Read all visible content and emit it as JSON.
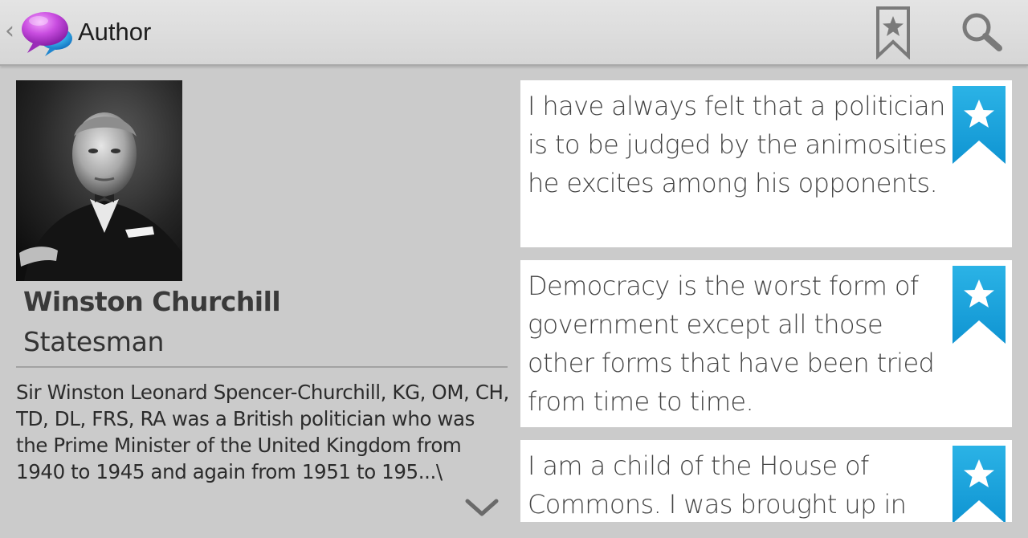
{
  "actionbar": {
    "title": "Author",
    "up_icon": "chevron-left-icon",
    "app_icon": "speech-bubbles-icon",
    "actions": [
      {
        "name": "bookmark-star-icon"
      },
      {
        "name": "search-icon"
      }
    ]
  },
  "author": {
    "name": "Winston Churchill",
    "role": "Statesman",
    "bio": "Sir Winston Leonard Spencer-Churchill, KG, OM, CH, TD, DL, FRS, RA was a British politician who was the Prime Minister of the United Kingdom from 1940 to 1945 and again from 1951 to 195...\\",
    "expand_icon": "chevron-down-icon"
  },
  "quotes": [
    {
      "text": "I have always felt that a politician is to be judged by the animosities he excites among his opponents."
    },
    {
      "text": "Democracy is the worst form of government except all those other forms that have been tried from time to time."
    },
    {
      "text": "I am a child of the House of Commons. I was brought up in"
    }
  ],
  "colors": {
    "background": "#cbcbcb",
    "actionbar": "#dcdcdc",
    "card": "#ffffff",
    "ribbon": "#1aa3dc"
  }
}
